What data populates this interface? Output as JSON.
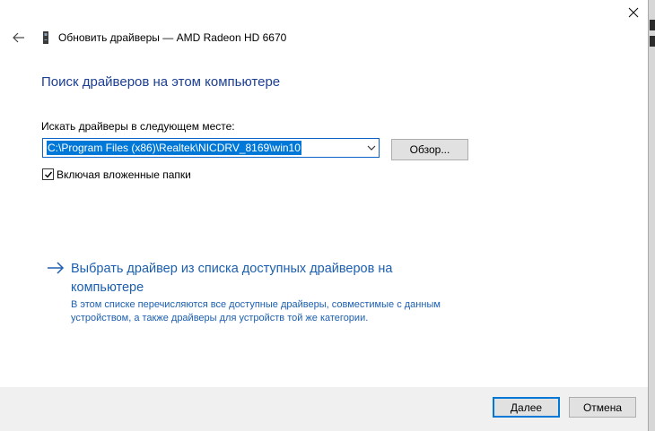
{
  "window": {
    "title": "Обновить драйверы — AMD Radeon HD 6670"
  },
  "page": {
    "heading": "Поиск драйверов на этом компьютере",
    "path_label": "Искать драйверы в следующем месте:",
    "path_value": "C:\\Program Files (x86)\\Realtek\\NICDRV_8169\\win10",
    "browse_label": "Обзор...",
    "include_subfolders_label": "Включая вложенные папки",
    "include_subfolders_checked": true,
    "pick_link_text": "Выбрать драйвер из списка доступных драйверов на компьютере",
    "pick_link_description": "В этом списке перечисляются все доступные драйверы, совместимые с данным устройством, а также драйверы для устройств той же категории."
  },
  "footer": {
    "next_label": "Далее",
    "cancel_label": "Отмена"
  },
  "colors": {
    "heading": "#1c3f93",
    "link": "#1c5fb0",
    "accent": "#0078d7",
    "footer_bg": "#f0f0f0"
  },
  "icons": {
    "back": "back-arrow-icon",
    "device": "device-icon",
    "close": "close-icon",
    "combo_dropdown": "chevron-down-icon",
    "check": "checkmark-icon",
    "link": "arrow-right-icon"
  }
}
